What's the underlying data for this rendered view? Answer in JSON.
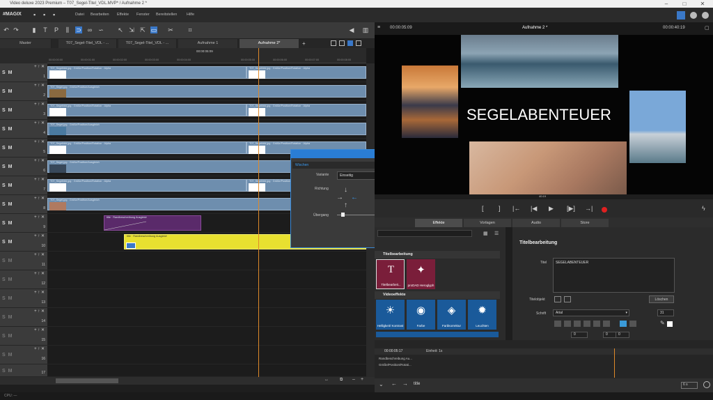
{
  "window": {
    "title": "Video deluxe 2023 Premium – T07_Segel-Titel_VDL.MVP* / Aufnahme 2 *"
  },
  "menubar": {
    "logo": "#MAGIX",
    "items": [
      "Datei",
      "Bearbeiten",
      "Effekte",
      "Fenster",
      "Bereitstellen",
      "Hilfe"
    ]
  },
  "tabs": [
    {
      "label": "Master"
    },
    {
      "label": "T07_Segel-Titel_VDL - ..."
    },
    {
      "label": "T07_Segel-Titel_VDL - ..."
    },
    {
      "label": "Aufnahme 1"
    },
    {
      "label": "Aufnahme 2*"
    }
  ],
  "ruler": {
    "timecode": "00:00:05:09",
    "labels": [
      "00:00:00:00",
      "00:00:01:00",
      "00:00:02:00",
      "00:00:03:00",
      "00:00:04:00",
      "00:00:05:00",
      "00:00:06:00",
      "00:00:07:00",
      "00:00:08:00"
    ]
  },
  "tracks": {
    "controls": "S M",
    "numbers": [
      "1",
      "2",
      "3",
      "4",
      "5",
      "6",
      "7",
      "8",
      "9",
      "10",
      "11",
      "12",
      "13",
      "14",
      "15",
      "16",
      "17"
    ]
  },
  "clips": {
    "t1a": "T07_Segelbild.jpg · Größe/Position/Rotation · Alpha",
    "t1b": "T07_Segelbild.jpg · Größe/Position/Rotation · Alpha",
    "t2": "T07_Segel.jpg · Größe/Position/Ausgleich",
    "t3a": "T07_Segelbild.jpg · Größe/Position/Rotation · Alpha",
    "t3b": "T07_Segelbild.jpg · Größe/Position/Rotation · Alpha",
    "t4": "T07_Segel.jpg · Größe/Position/Ausgleich",
    "t5a": "T07_Segelbild.jpg · Größe/Position/Rotation · Alpha",
    "t5b": "T07_Segelbild.jpg · Größe/Position/Rotation · Alpha",
    "t6": "T07_Segel.jpg · Größe/Position/Ausgleich",
    "t7a": "T07_Segelbild.jpg · Größe/Position/Rotation · Alpha",
    "t7b": "T07_Segelbild.jpg · Größe/Position/Rotation · Alpha",
    "t8": "T07_Segel.jpg · Größe/Position/Ausgleich",
    "t9": "title · Randbeschreibung Ausgleich",
    "t10": "title · Randbeschreibung Ausgleich"
  },
  "dialog": {
    "section": "Wischen",
    "variante_label": "Variante",
    "variante_value": "Einseitig",
    "richtung_label": "Richtung",
    "uebergang_label": "Übergang"
  },
  "preview": {
    "timecode_left": "00:00:05:09",
    "title": "Aufnahme 2 *",
    "timecode_right": "00:00:40:19",
    "overlay_text": "SEGELABENTEUER",
    "pos_label": "40:19"
  },
  "panel_tabs": [
    "Effekte",
    "Vorlagen",
    "Audio",
    "Store"
  ],
  "effects": {
    "section1": "Titelbearbeitung",
    "tile1": "Titelbearbeit...",
    "tile2": "proDAD Heroglyph",
    "section2": "Videoeffekte",
    "tile3": "Helligkeit/ Kontrast",
    "tile4": "Farbe",
    "tile5": "Farbkorrektur",
    "tile6": "Leuchten"
  },
  "props": {
    "heading": "Titelbearbeitung",
    "titel_label": "Titel",
    "titel_value": "SEGELABENTEUER",
    "titelobjekt_label": "Titelobjekt",
    "loeschen": "Löschen",
    "schrift_label": "Schrift",
    "font_value": "Arial",
    "size_value": "31",
    "spacing1": "0",
    "spacing2": "0",
    "spacing3": "0"
  },
  "keyframes": {
    "time": "00:00:05:17",
    "einheit": "Einheit: 1s",
    "row1": "Randbeschreibung Au...",
    "row2": "Größe/Position/Rotati..."
  },
  "bottombar": {
    "label": "title",
    "zoom": "6 s"
  },
  "statusbar": {
    "text": "CPU: —"
  },
  "colors": {
    "accent": "#3a8ad8",
    "clip": "#6e8eae",
    "title_clip": "#e8e030",
    "purple": "#6a2e7a",
    "playhead": "#e08a2a",
    "record": "#e02020"
  }
}
